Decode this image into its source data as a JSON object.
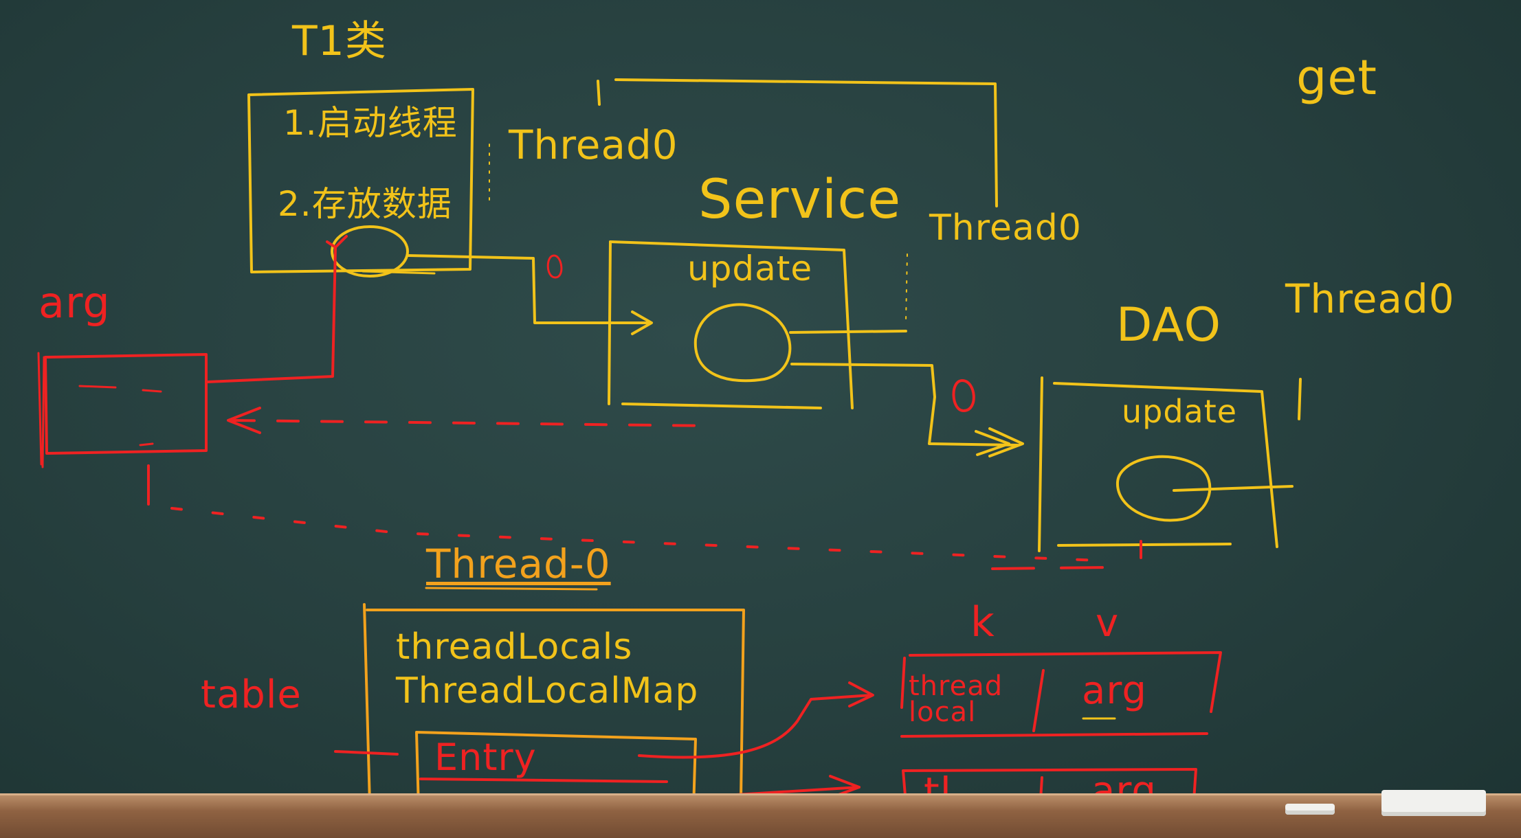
{
  "labels": {
    "tijiao": "T1类",
    "step1": "1.启动线程",
    "step2": "2.存放数据",
    "thread0_top": "Thread0",
    "service": "Service",
    "thread0_service": "Thread0",
    "update_service": "update",
    "get": "get",
    "dao": "DAO",
    "thread0_dao": "Thread0",
    "update_dao": "update",
    "arg": "arg",
    "zero_1": "0",
    "zero_2": "0",
    "thread_title": "Thread-0",
    "tl_line1": "threadLocals",
    "tl_line2": "ThreadLocalMap",
    "entry": "Entry",
    "table": "table",
    "k": "k",
    "v": "v",
    "threadlocal": "thread local",
    "arg_cell": "arg",
    "tl": "tl",
    "arg_cell2": "arg"
  },
  "colors": {
    "yellow": "#f2c31a",
    "orange": "#f3a21d",
    "red": "#ef2222",
    "board": "#263f3e"
  }
}
